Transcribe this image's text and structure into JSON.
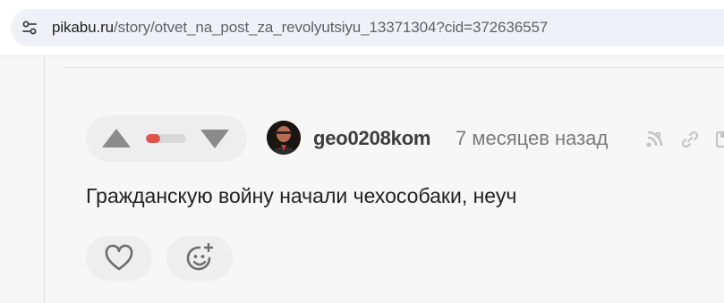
{
  "browser": {
    "url_host": "pikabu.ru",
    "url_path": "/story/otvet_na_post_za_revolyutsiyu_13371304?cid=372636557",
    "site_info_icon": "tune-icon"
  },
  "comment": {
    "rating_fill_fraction": 0.35,
    "rating_color": "#e0534a",
    "author": "geo0208kom",
    "time": "7 месяцев назад",
    "text": "Гражданскую войну начали чехособаки, неуч",
    "icons": [
      "branch-icon",
      "link-icon",
      "save-icon"
    ]
  },
  "actions": {
    "like_icon": "heart-icon",
    "react_icon": "add-reaction-icon"
  }
}
